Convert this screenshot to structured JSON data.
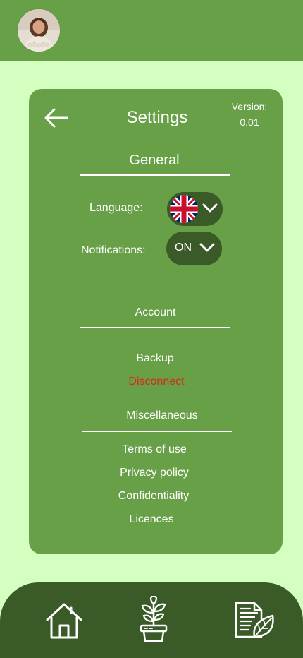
{
  "header": {
    "avatar_icon": "user-avatar-photo"
  },
  "settings": {
    "title": "Settings",
    "back_icon": "arrow-left-icon",
    "version_label": "Version:",
    "version_value": "0.01"
  },
  "general": {
    "heading": "General",
    "language_label": "Language:",
    "language_icon": "uk-flag-icon",
    "notifications_label": "Notifications:",
    "notifications_value": "ON"
  },
  "account": {
    "heading": "Account",
    "backup_label": "Backup",
    "disconnect_label": "Disconnect"
  },
  "misc": {
    "heading": "Miscellaneous",
    "terms_label": "Terms of use",
    "privacy_label": "Privacy policy",
    "confidentiality_label": "Confidentiality",
    "licences_label": "Licences"
  },
  "bottom_nav": {
    "home_icon": "home-icon",
    "plant_icon": "plant-pot-icon",
    "notes_icon": "document-leaf-icon"
  },
  "colors": {
    "background": "#D3FFC0",
    "primary": "#67A047",
    "dark": "#3A5A27",
    "danger": "#D42A1A",
    "text": "#FFFFFF"
  }
}
